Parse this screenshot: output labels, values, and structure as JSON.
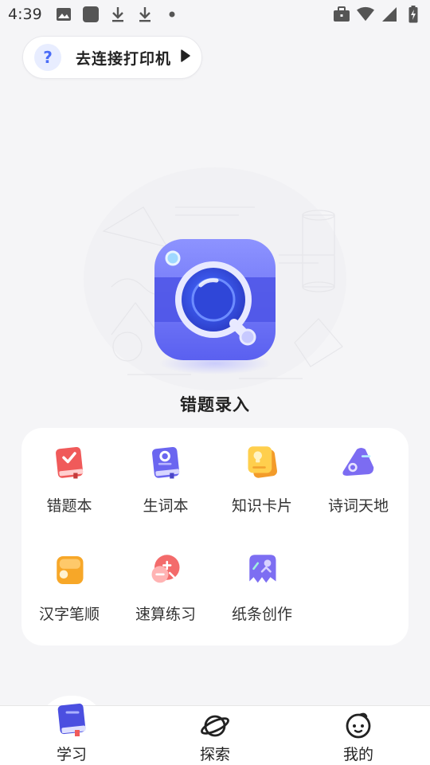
{
  "status_bar": {
    "time": "4:39",
    "left_icons": [
      "image-icon",
      "square-app-icon",
      "download-icon",
      "download-icon",
      "dot-icon"
    ],
    "right_icons": [
      "briefcase-icon",
      "wifi-icon",
      "signal-icon",
      "battery-charging-icon"
    ]
  },
  "printer_chip": {
    "icon": "help-icon",
    "help_glyph": "?",
    "label": "去连接打印机",
    "arrow_icon": "play-arrow-icon"
  },
  "hero": {
    "icon": "camera-icon",
    "title": "错题录入"
  },
  "tools": [
    {
      "label": "错题本",
      "icon": "mistake-book-icon",
      "color": "#f05a5a"
    },
    {
      "label": "生词本",
      "icon": "vocabulary-book-icon",
      "color": "#6b66f0"
    },
    {
      "label": "知识卡片",
      "icon": "knowledge-card-icon",
      "color": "#f7b733"
    },
    {
      "label": "诗词天地",
      "icon": "poetry-icon",
      "color": "#7c6cf2"
    },
    {
      "label": "汉字笔顺",
      "icon": "stroke-order-icon",
      "color": "#f7a728"
    },
    {
      "label": "速算练习",
      "icon": "quick-calc-icon",
      "color": "#f36b6b"
    },
    {
      "label": "纸条创作",
      "icon": "note-create-icon",
      "color": "#7d6ef2"
    }
  ],
  "bottom_nav": [
    {
      "label": "学习",
      "icon": "study-book-icon",
      "active": true
    },
    {
      "label": "探索",
      "icon": "planet-icon",
      "active": false
    },
    {
      "label": "我的",
      "icon": "face-icon",
      "active": false
    }
  ],
  "colors": {
    "accent": "#5b63f0",
    "background": "#f5f5f7"
  }
}
